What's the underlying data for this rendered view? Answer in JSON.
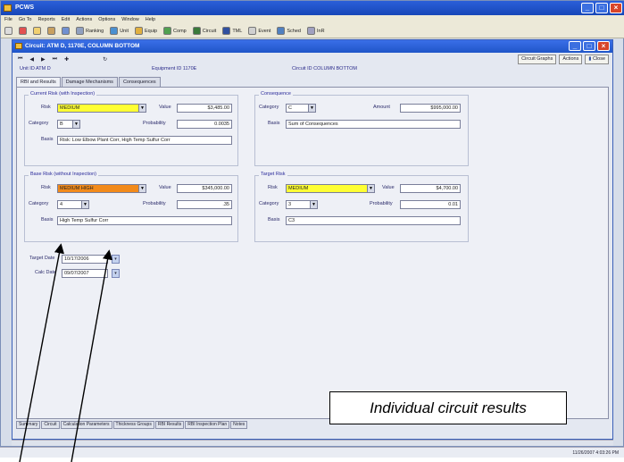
{
  "app": {
    "title": "PCWS"
  },
  "menu": [
    "File",
    "Go To",
    "Reports",
    "Edit",
    "Actions",
    "Options",
    "Window",
    "Help"
  ],
  "toolbar": [
    {
      "label": "",
      "icon": "print-icon"
    },
    {
      "label": "",
      "icon": "delete-icon"
    },
    {
      "label": "",
      "icon": "copy-icon"
    },
    {
      "label": "",
      "icon": "paste-icon"
    },
    {
      "label": "",
      "icon": "save-icon"
    },
    {
      "label": "Ranking",
      "icon": "ranking-icon"
    },
    {
      "label": "Unit",
      "icon": "unit-icon"
    },
    {
      "label": "Equip",
      "icon": "equip-icon"
    },
    {
      "label": "Comp",
      "icon": "comp-icon"
    },
    {
      "label": "Circuit",
      "icon": "circuit-icon"
    },
    {
      "label": "TML",
      "icon": "tml-icon"
    },
    {
      "label": "Event",
      "icon": "event-icon"
    },
    {
      "label": "Sched",
      "icon": "schedule-icon"
    },
    {
      "label": "InR",
      "icon": "inr-icon"
    }
  ],
  "child": {
    "title": "Circuit: ATM D, 1170E, COLUMN BOTTOM",
    "buttons": [
      "Circuit Graphs",
      "Actions",
      "Close"
    ],
    "unit_id": "Unit ID ATM D",
    "equipment_id": "Equipment ID 1170E",
    "circuit_id": "Circuit ID COLUMN BOTTOM",
    "tabs": [
      "RBI and Results",
      "Damage Mechanisms",
      "Consequences"
    ]
  },
  "current_risk": {
    "title": "Current Risk (with Inspection)",
    "risk_label": "Risk",
    "risk_value": "MEDIUM",
    "value_label": "Value",
    "value": "$3,485.00",
    "category_label": "Category",
    "category": "B",
    "probability_label": "Probability",
    "probability": "0.0035",
    "basis_label": "Basis",
    "basis": "Risk: Low Elbow Plant Corr, High Temp Sulfur Corr"
  },
  "consequence": {
    "title": "Consequence",
    "category_label": "Category",
    "category": "C",
    "amount_label": "Amount",
    "amount": "$995,000.00",
    "basis_label": "Basis",
    "basis": "Sum of Consequences"
  },
  "base_risk": {
    "title": "Base Risk (without Inspection)",
    "risk_label": "Risk",
    "risk_value": "MEDIUM HIGH",
    "value_label": "Value",
    "value": "$345,000.00",
    "category_label": "Category",
    "category": "4",
    "probability_label": "Probability",
    "probability": ".35",
    "basis_label": "Basis",
    "basis": "High Temp Sulfur Corr"
  },
  "target_risk": {
    "title": "Target Risk",
    "risk_label": "Risk",
    "risk_value": "MEDIUM",
    "value_label": "Value",
    "value": "$4,700.00",
    "category_label": "Category",
    "category": "3",
    "probability_label": "Probability",
    "probability": "0.01",
    "basis_label": "Basis",
    "basis": "C3"
  },
  "dates": {
    "target_label": "Target Date",
    "target": "10/17/2006",
    "calc_label": "Calc Date",
    "calc": "09/07/2007"
  },
  "bottom_tabs": [
    "Summary",
    "Circuit",
    "Calculation Parameters",
    "Thickness Groups",
    "RBI Results",
    "RBI Inspection Plan",
    "Notes"
  ],
  "status": {
    "timestamp": "11/26/2007 4:03:26 PM"
  },
  "callout": {
    "text": "Individual circuit results"
  }
}
